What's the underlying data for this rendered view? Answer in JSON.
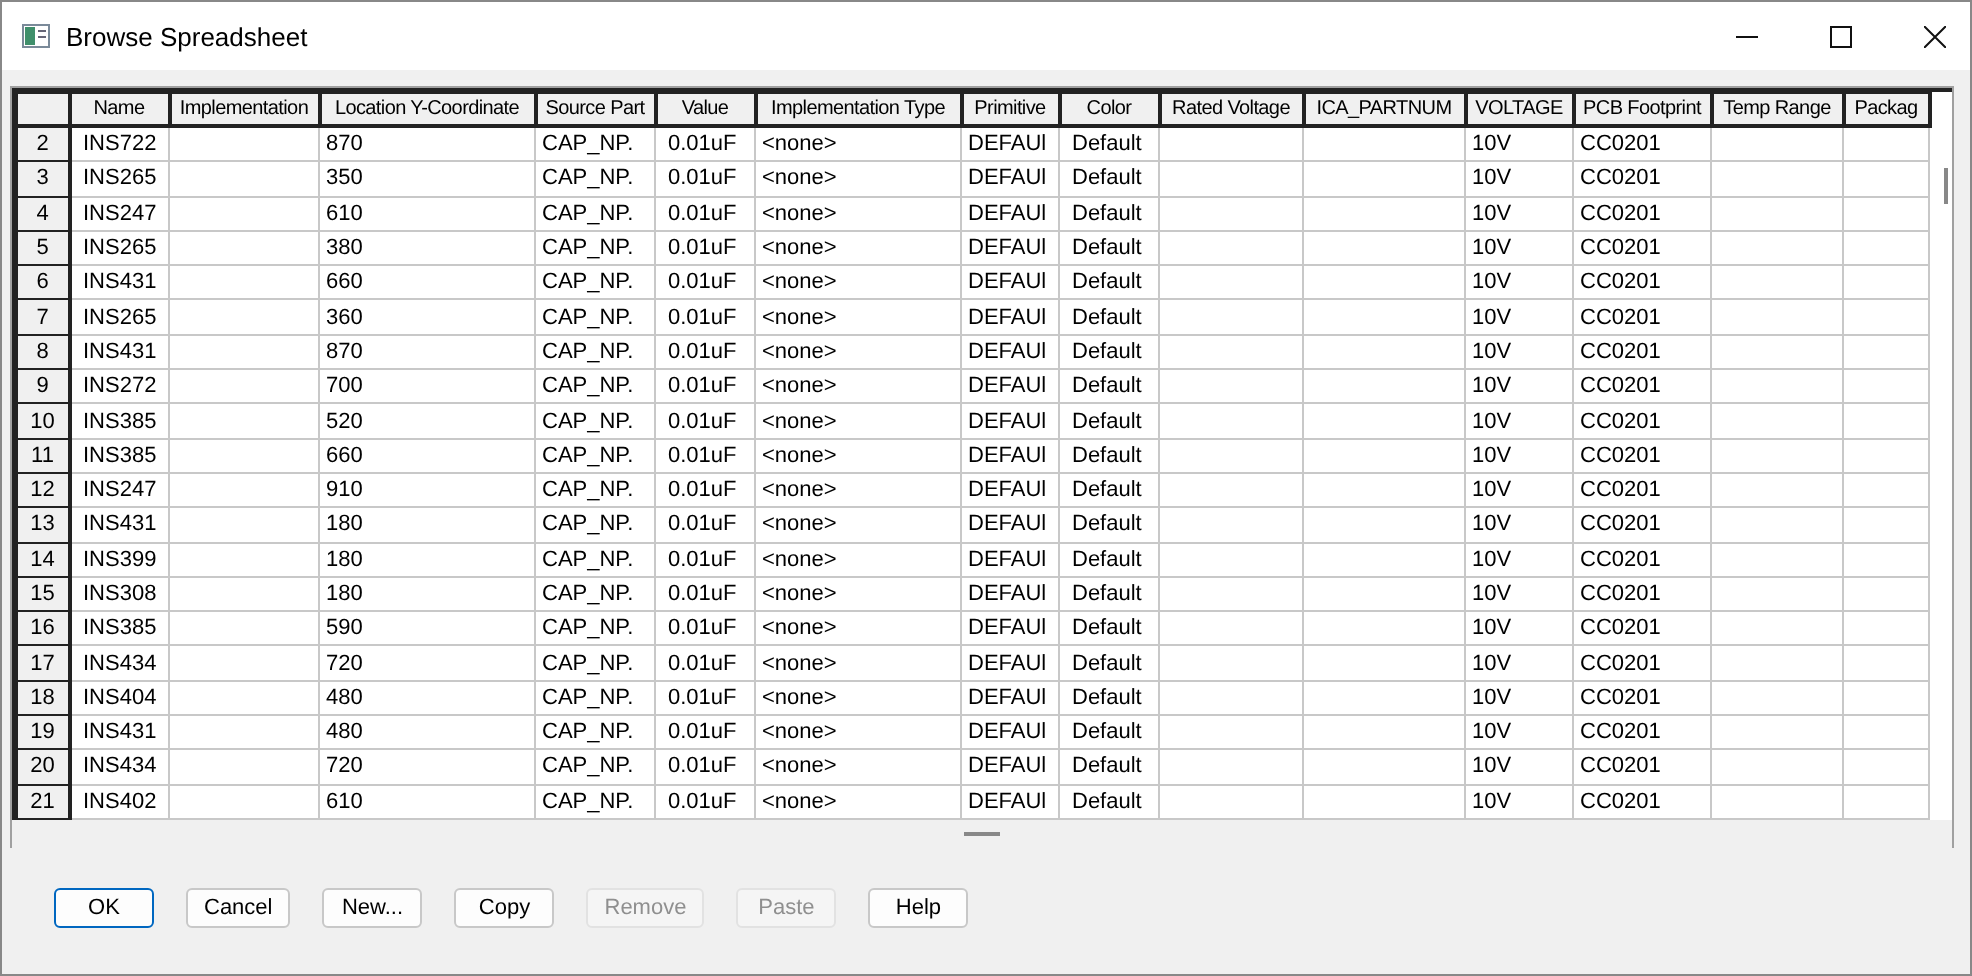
{
  "window": {
    "title": "Browse Spreadsheet"
  },
  "table": {
    "columns": [
      "Name",
      "Implementation",
      "Location Y-Coordinate",
      "Source Part",
      "Value",
      "Implementation Type",
      "Primitive",
      "Color",
      "Rated Voltage",
      "ICA_PARTNUM",
      "VOLTAGE",
      "PCB Footprint",
      "Temp Range",
      "Packag"
    ],
    "rows": [
      {
        "number": "2",
        "cells": [
          "INS722",
          "",
          "870",
          "CAP_NP.",
          "0.01uF",
          "<none>",
          "DEFAUl",
          "Default",
          "",
          "",
          "10V",
          "CC0201",
          "",
          ""
        ]
      },
      {
        "number": "3",
        "cells": [
          "INS265",
          "",
          "350",
          "CAP_NP.",
          "0.01uF",
          "<none>",
          "DEFAUl",
          "Default",
          "",
          "",
          "10V",
          "CC0201",
          "",
          ""
        ]
      },
      {
        "number": "4",
        "cells": [
          "INS247",
          "",
          "610",
          "CAP_NP.",
          "0.01uF",
          "<none>",
          "DEFAUl",
          "Default",
          "",
          "",
          "10V",
          "CC0201",
          "",
          ""
        ]
      },
      {
        "number": "5",
        "cells": [
          "INS265",
          "",
          "380",
          "CAP_NP.",
          "0.01uF",
          "<none>",
          "DEFAUl",
          "Default",
          "",
          "",
          "10V",
          "CC0201",
          "",
          ""
        ]
      },
      {
        "number": "6",
        "cells": [
          "INS431",
          "",
          "660",
          "CAP_NP.",
          "0.01uF",
          "<none>",
          "DEFAUl",
          "Default",
          "",
          "",
          "10V",
          "CC0201",
          "",
          ""
        ]
      },
      {
        "number": "7",
        "cells": [
          "INS265",
          "",
          "360",
          "CAP_NP.",
          "0.01uF",
          "<none>",
          "DEFAUl",
          "Default",
          "",
          "",
          "10V",
          "CC0201",
          "",
          ""
        ]
      },
      {
        "number": "8",
        "cells": [
          "INS431",
          "",
          "870",
          "CAP_NP.",
          "0.01uF",
          "<none>",
          "DEFAUl",
          "Default",
          "",
          "",
          "10V",
          "CC0201",
          "",
          ""
        ]
      },
      {
        "number": "9",
        "cells": [
          "INS272",
          "",
          "700",
          "CAP_NP.",
          "0.01uF",
          "<none>",
          "DEFAUl",
          "Default",
          "",
          "",
          "10V",
          "CC0201",
          "",
          ""
        ]
      },
      {
        "number": "10",
        "cells": [
          "INS385",
          "",
          "520",
          "CAP_NP.",
          "0.01uF",
          "<none>",
          "DEFAUl",
          "Default",
          "",
          "",
          "10V",
          "CC0201",
          "",
          ""
        ]
      },
      {
        "number": "11",
        "cells": [
          "INS385",
          "",
          "660",
          "CAP_NP.",
          "0.01uF",
          "<none>",
          "DEFAUl",
          "Default",
          "",
          "",
          "10V",
          "CC0201",
          "",
          ""
        ]
      },
      {
        "number": "12",
        "cells": [
          "INS247",
          "",
          "910",
          "CAP_NP.",
          "0.01uF",
          "<none>",
          "DEFAUl",
          "Default",
          "",
          "",
          "10V",
          "CC0201",
          "",
          ""
        ]
      },
      {
        "number": "13",
        "cells": [
          "INS431",
          "",
          "180",
          "CAP_NP.",
          "0.01uF",
          "<none>",
          "DEFAUl",
          "Default",
          "",
          "",
          "10V",
          "CC0201",
          "",
          ""
        ]
      },
      {
        "number": "14",
        "cells": [
          "INS399",
          "",
          "180",
          "CAP_NP.",
          "0.01uF",
          "<none>",
          "DEFAUl",
          "Default",
          "",
          "",
          "10V",
          "CC0201",
          "",
          ""
        ]
      },
      {
        "number": "15",
        "cells": [
          "INS308",
          "",
          "180",
          "CAP_NP.",
          "0.01uF",
          "<none>",
          "DEFAUl",
          "Default",
          "",
          "",
          "10V",
          "CC0201",
          "",
          ""
        ]
      },
      {
        "number": "16",
        "cells": [
          "INS385",
          "",
          "590",
          "CAP_NP.",
          "0.01uF",
          "<none>",
          "DEFAUl",
          "Default",
          "",
          "",
          "10V",
          "CC0201",
          "",
          ""
        ]
      },
      {
        "number": "17",
        "cells": [
          "INS434",
          "",
          "720",
          "CAP_NP.",
          "0.01uF",
          "<none>",
          "DEFAUl",
          "Default",
          "",
          "",
          "10V",
          "CC0201",
          "",
          ""
        ]
      },
      {
        "number": "18",
        "cells": [
          "INS404",
          "",
          "480",
          "CAP_NP.",
          "0.01uF",
          "<none>",
          "DEFAUl",
          "Default",
          "",
          "",
          "10V",
          "CC0201",
          "",
          ""
        ]
      },
      {
        "number": "19",
        "cells": [
          "INS431",
          "",
          "480",
          "CAP_NP.",
          "0.01uF",
          "<none>",
          "DEFAUl",
          "Default",
          "",
          "",
          "10V",
          "CC0201",
          "",
          ""
        ]
      },
      {
        "number": "20",
        "cells": [
          "INS434",
          "",
          "720",
          "CAP_NP.",
          "0.01uF",
          "<none>",
          "DEFAUl",
          "Default",
          "",
          "",
          "10V",
          "CC0201",
          "",
          ""
        ]
      },
      {
        "number": "21",
        "cells": [
          "INS402",
          "",
          "610",
          "CAP_NP.",
          "0.01uF",
          "<none>",
          "DEFAUl",
          "Default",
          "",
          "",
          "10V",
          "CC0201",
          "",
          ""
        ]
      }
    ]
  },
  "buttons": [
    {
      "label": "OK",
      "default": true,
      "disabled": false
    },
    {
      "label": "Cancel",
      "default": false,
      "disabled": false
    },
    {
      "label": "New...",
      "default": false,
      "disabled": false
    },
    {
      "label": "Copy",
      "default": false,
      "disabled": false
    },
    {
      "label": "Remove",
      "default": false,
      "disabled": true
    },
    {
      "label": "Paste",
      "default": false,
      "disabled": true
    },
    {
      "label": "Help",
      "default": false,
      "disabled": false
    }
  ]
}
